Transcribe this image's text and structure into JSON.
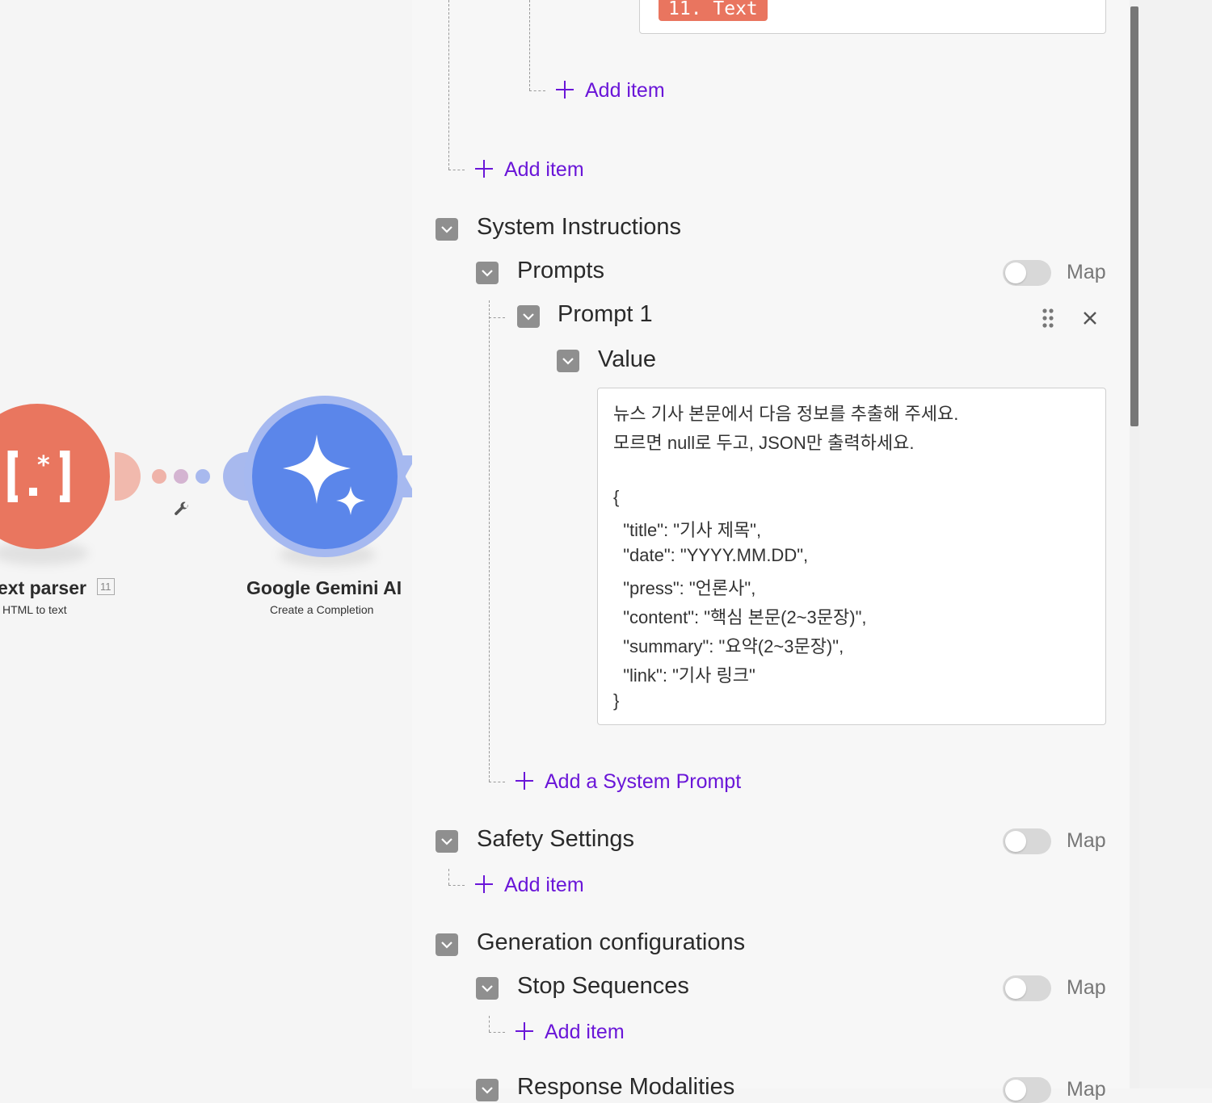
{
  "canvas": {
    "module1": {
      "title": "ext parser",
      "subtitle": "HTML to text",
      "badge": "11",
      "icon_glyph": "[.*]",
      "color": "#e9765f"
    },
    "module2": {
      "title": "Google Gemini AI",
      "subtitle": "Create a Completion",
      "color": "#5b86ea"
    }
  },
  "panel": {
    "text_pill": "11. Text",
    "add_item_nested": "Add item",
    "add_item_outer": "Add item",
    "system_instructions": {
      "label": "System Instructions",
      "prompts": {
        "label": "Prompts",
        "map_label": "Map",
        "map_enabled": false,
        "prompt1": {
          "label": "Prompt 1",
          "value_label": "Value",
          "value_lines": [
            "뉴스 기사 본문에서 다음 정보를 추출해 주세요.",
            "모르면 null로 두고, JSON만 출력하세요.",
            "",
            "{",
            "  \"title\": \"기사 제목\",",
            "  \"date\": \"YYYY.MM.DD\",",
            "  \"press\": \"언론사\",",
            "  \"content\": \"핵심 본문(2~3문장)\",",
            "  \"summary\": \"요약(2~3문장)\",",
            "  \"link\": \"기사 링크\"",
            "}"
          ]
        },
        "add_label": "Add a System Prompt"
      }
    },
    "safety_settings": {
      "label": "Safety Settings",
      "map_label": "Map",
      "map_enabled": false,
      "add_label": "Add item"
    },
    "generation": {
      "label": "Generation configurations",
      "stop_sequences": {
        "label": "Stop Sequences",
        "map_label": "Map",
        "map_enabled": false,
        "add_label": "Add item"
      },
      "response_modalities": {
        "label": "Response Modalities",
        "map_label": "Map"
      }
    },
    "accent_color": "#6a16d8"
  }
}
